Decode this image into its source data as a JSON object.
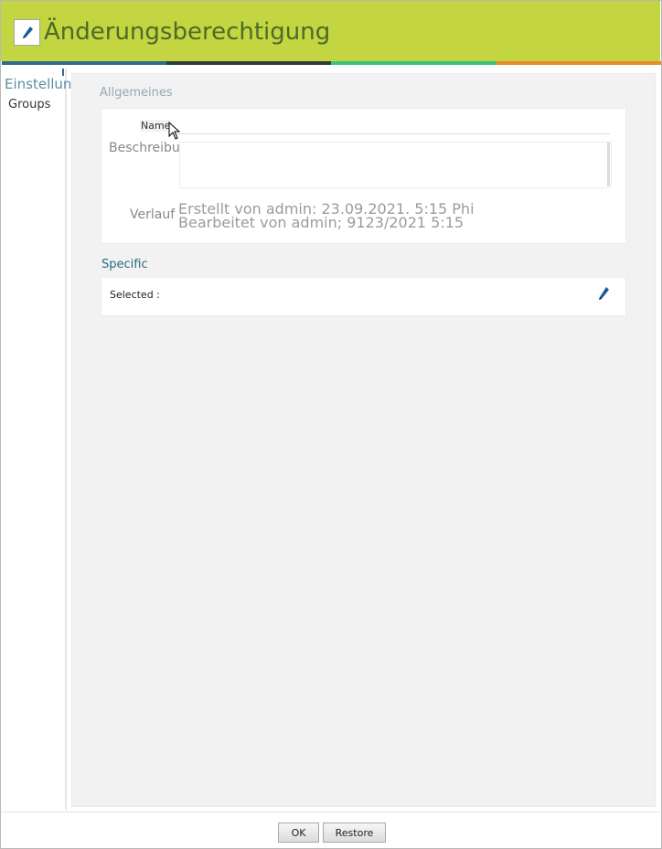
{
  "window": {
    "title": "Änderungsberechtigung",
    "icon": "pencil-icon",
    "accent": "#c3d540",
    "stripe_colors": [
      "#2e6b8c",
      "#2d3d3a",
      "#3fbf7a",
      "#e88c2c"
    ]
  },
  "sidebar": {
    "heading": "Einstellungen",
    "items": [
      {
        "label": "Groups"
      }
    ]
  },
  "general": {
    "title": "Allgemeines",
    "name_label": "Name",
    "name_value": "",
    "description_label": "Beschreibung:",
    "description_value": "",
    "history_label": "Verlauf",
    "history": [
      "Erstellt von admin: 23.09.2021. 5:15 Phi",
      "Bearbeitet von admin; 9123/2021 5:15"
    ]
  },
  "specific": {
    "title": "Specific",
    "selected_label": "Selected :",
    "edit_icon": "pencil-icon"
  },
  "footer": {
    "ok_label": "OK",
    "restore_label": "Restore"
  }
}
